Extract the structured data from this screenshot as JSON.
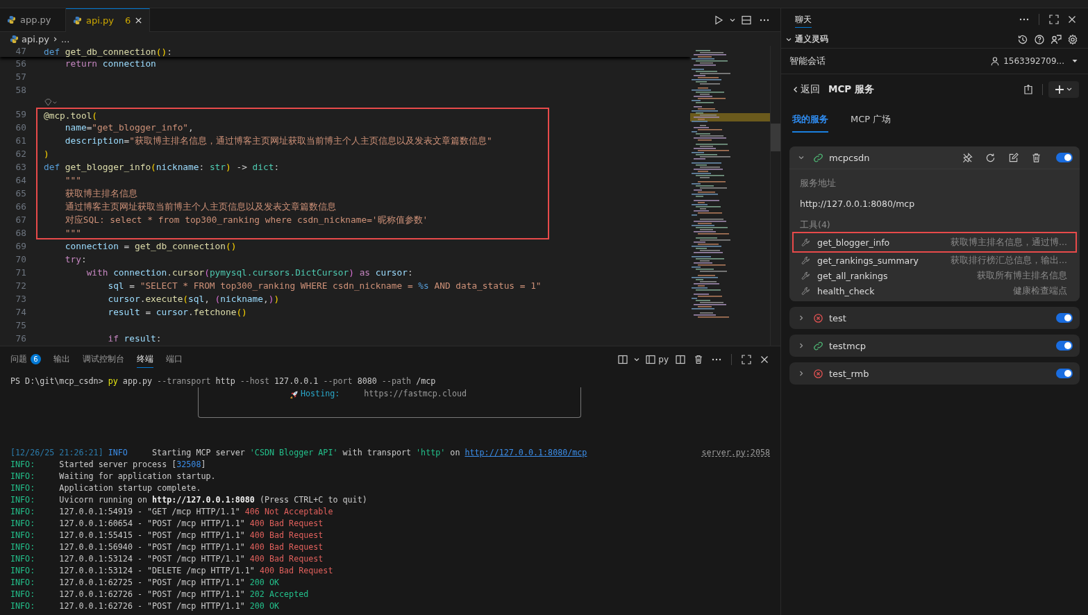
{
  "editor_tabs": [
    {
      "label": "app.py",
      "selected": false,
      "warning": false
    },
    {
      "label": "api.py",
      "selected": true,
      "warning": true,
      "problems": "6"
    }
  ],
  "breadcrumb": [
    "api.py",
    "..."
  ],
  "sticky_line": {
    "number": "47",
    "tokens": [
      {
        "text": "def",
        "kind": "storage"
      },
      {
        "text": " get_db_connection",
        "kind": "fn"
      },
      {
        "text": "()",
        "kind": "bracket"
      },
      {
        "text": ":",
        "kind": "plain"
      }
    ]
  },
  "code_lines": [
    {
      "number": "56",
      "boxed": false,
      "tokens": [
        {
          "text": "    return",
          "kind": "control"
        },
        {
          "text": " connection",
          "kind": "var"
        }
      ]
    },
    {
      "number": "57",
      "boxed": false
    },
    {
      "number": "58",
      "boxed": false
    },
    {
      "number": "59",
      "boxed": true,
      "codelens": true,
      "tokens": [
        {
          "text": "@mcp.tool",
          "kind": "fn"
        },
        {
          "text": "(",
          "kind": "bracket"
        }
      ]
    },
    {
      "number": "60",
      "boxed": true,
      "tokens": [
        {
          "text": "    name",
          "kind": "var"
        },
        {
          "text": "=",
          "kind": "plain"
        },
        {
          "text": "\"get_blogger_info\"",
          "kind": "str"
        },
        {
          "text": ",",
          "kind": "plain"
        }
      ]
    },
    {
      "number": "61",
      "boxed": true,
      "tokens": [
        {
          "text": "    description",
          "kind": "var"
        },
        {
          "text": "=",
          "kind": "plain"
        },
        {
          "text": "\"获取博主排名信息，通过博客主页网址获取当前博主个人主页信息以及发表文章篇数信息\"",
          "kind": "str"
        }
      ]
    },
    {
      "number": "62",
      "boxed": true,
      "tokens": [
        {
          "text": ")",
          "kind": "bracket"
        }
      ]
    },
    {
      "number": "63",
      "boxed": true,
      "tokens": [
        {
          "text": "def",
          "kind": "storage"
        },
        {
          "text": " get_blogger_info",
          "kind": "fn"
        },
        {
          "text": "(",
          "kind": "bracket"
        },
        {
          "text": "nickname",
          "kind": "var"
        },
        {
          "text": ": ",
          "kind": "plain"
        },
        {
          "text": "str",
          "kind": "type"
        },
        {
          "text": ")",
          "kind": "bracket"
        },
        {
          "text": " -> ",
          "kind": "plain"
        },
        {
          "text": "dict",
          "kind": "type"
        },
        {
          "text": ":",
          "kind": "plain"
        }
      ]
    },
    {
      "number": "64",
      "boxed": true,
      "tokens": [
        {
          "text": "    \"\"\"",
          "kind": "str"
        }
      ]
    },
    {
      "number": "65",
      "boxed": true,
      "tokens": [
        {
          "text": "    获取博主排名信息",
          "kind": "str"
        }
      ]
    },
    {
      "number": "66",
      "boxed": true,
      "tokens": [
        {
          "text": "    通过博客主页网址获取当前博主个人主页信息以及发表文章篇数信息",
          "kind": "str"
        }
      ]
    },
    {
      "number": "67",
      "boxed": true,
      "tokens": [
        {
          "text": "    对应SQL: select * from top300_ranking where csdn_nickname='昵称值参数'",
          "kind": "str"
        }
      ]
    },
    {
      "number": "68",
      "boxed": true,
      "tokens": [
        {
          "text": "    \"\"\"",
          "kind": "str"
        }
      ]
    },
    {
      "number": "69",
      "boxed": false,
      "tokens": [
        {
          "text": "    connection",
          "kind": "var"
        },
        {
          "text": " = ",
          "kind": "plain"
        },
        {
          "text": "get_db_connection",
          "kind": "fn"
        },
        {
          "text": "()",
          "kind": "bracket"
        }
      ]
    },
    {
      "number": "70",
      "boxed": false,
      "tokens": [
        {
          "text": "    try",
          "kind": "control"
        },
        {
          "text": ":",
          "kind": "plain"
        }
      ]
    },
    {
      "number": "71",
      "boxed": false,
      "tokens": [
        {
          "text": "        with",
          "kind": "control"
        },
        {
          "text": " connection",
          "kind": "var"
        },
        {
          "text": ".",
          "kind": "plain"
        },
        {
          "text": "cursor",
          "kind": "fn"
        },
        {
          "text": "(",
          "kind": "bracket2"
        },
        {
          "text": "pymysql.cursors.DictCursor",
          "kind": "type"
        },
        {
          "text": ")",
          "kind": "bracket2"
        },
        {
          "text": " as",
          "kind": "control"
        },
        {
          "text": " cursor",
          "kind": "var"
        },
        {
          "text": ":",
          "kind": "plain"
        }
      ]
    },
    {
      "number": "72",
      "boxed": false,
      "tokens": [
        {
          "text": "            sql",
          "kind": "var"
        },
        {
          "text": " = ",
          "kind": "plain"
        },
        {
          "text": "\"SELECT * FROM top300_ranking WHERE csdn_nickname = ",
          "kind": "str"
        },
        {
          "text": "%s",
          "kind": "storage"
        },
        {
          "text": " AND data_status = 1\"",
          "kind": "str"
        }
      ]
    },
    {
      "number": "73",
      "boxed": false,
      "tokens": [
        {
          "text": "            cursor",
          "kind": "var"
        },
        {
          "text": ".",
          "kind": "plain"
        },
        {
          "text": "execute",
          "kind": "fn"
        },
        {
          "text": "(",
          "kind": "bracket"
        },
        {
          "text": "sql",
          "kind": "var"
        },
        {
          "text": ", ",
          "kind": "plain"
        },
        {
          "text": "(",
          "kind": "bracket2"
        },
        {
          "text": "nickname",
          "kind": "var"
        },
        {
          "text": ",",
          "kind": "plain"
        },
        {
          "text": ")",
          "kind": "bracket2"
        },
        {
          "text": ")",
          "kind": "bracket"
        }
      ]
    },
    {
      "number": "74",
      "boxed": false,
      "tokens": [
        {
          "text": "            result",
          "kind": "var"
        },
        {
          "text": " = ",
          "kind": "plain"
        },
        {
          "text": "cursor",
          "kind": "var"
        },
        {
          "text": ".",
          "kind": "plain"
        },
        {
          "text": "fetchone",
          "kind": "fn"
        },
        {
          "text": "()",
          "kind": "bracket"
        }
      ]
    },
    {
      "number": "75",
      "boxed": false
    },
    {
      "number": "76",
      "boxed": false,
      "tokens": [
        {
          "text": "            if",
          "kind": "control"
        },
        {
          "text": " result",
          "kind": "var"
        },
        {
          "text": ":",
          "kind": "plain"
        }
      ]
    }
  ],
  "panel_tabs": [
    {
      "label": "问题",
      "selected": false,
      "badge": "6"
    },
    {
      "label": "输出",
      "selected": false
    },
    {
      "label": "调试控制台",
      "selected": false
    },
    {
      "label": "终端",
      "selected": true
    },
    {
      "label": "端口",
      "selected": false
    }
  ],
  "terminal_name": "py",
  "terminal": {
    "command": [
      {
        "text": "PS D:\\git\\mcp_csdn> ",
        "kind": "plain"
      },
      {
        "text": "py",
        "kind": "yellow"
      },
      {
        "text": " app.py ",
        "kind": "plain"
      },
      {
        "text": "--transport",
        "kind": "muted"
      },
      {
        "text": " http ",
        "kind": "plain"
      },
      {
        "text": "--host",
        "kind": "muted"
      },
      {
        "text": " 127.0.0.1 ",
        "kind": "plain"
      },
      {
        "text": "--port",
        "kind": "muted"
      },
      {
        "text": " 8080 ",
        "kind": "plain"
      },
      {
        "text": "--path",
        "kind": "muted"
      },
      {
        "text": " /mcp",
        "kind": "plain"
      }
    ],
    "banner": {
      "label": "Hosting:",
      "url": "https://fastmcp.cloud"
    },
    "log": [
      {
        "source": "server.py:2058",
        "tokens": [
          {
            "text": "[12/26/25 21:26:21]",
            "kind": "dim"
          },
          {
            "text": " INFO",
            "kind": "blue"
          },
          {
            "text": "     Starting MCP server ",
            "kind": "plain"
          },
          {
            "text": "'CSDN Blogger API'",
            "kind": "green"
          },
          {
            "text": " with transport ",
            "kind": "plain"
          },
          {
            "text": "'http'",
            "kind": "green"
          },
          {
            "text": " on ",
            "kind": "plain"
          },
          {
            "text": "http://127.0.0.1:8080/mcp",
            "kind": "link"
          }
        ]
      },
      {
        "tokens": [
          {
            "text": "INFO:",
            "kind": "green"
          },
          {
            "text": "     Started server process [",
            "kind": "plain"
          },
          {
            "text": "32508",
            "kind": "blue"
          },
          {
            "text": "]",
            "kind": "plain"
          }
        ]
      },
      {
        "tokens": [
          {
            "text": "INFO:",
            "kind": "green"
          },
          {
            "text": "     Waiting for application startup.",
            "kind": "plain"
          }
        ]
      },
      {
        "tokens": [
          {
            "text": "INFO:",
            "kind": "green"
          },
          {
            "text": "     Application startup complete.",
            "kind": "plain"
          }
        ]
      },
      {
        "tokens": [
          {
            "text": "INFO:",
            "kind": "green"
          },
          {
            "text": "     Uvicorn running on ",
            "kind": "plain"
          },
          {
            "text": "http://127.0.0.1:8080",
            "kind": "bold"
          },
          {
            "text": " (Press CTRL+C to quit)",
            "kind": "plain"
          }
        ]
      },
      {
        "tokens": [
          {
            "text": "INFO:",
            "kind": "green"
          },
          {
            "text": "     127.0.0.1:54919 - \"GET /mcp HTTP/1.1\" ",
            "kind": "plain"
          },
          {
            "text": "406 Not Acceptable",
            "kind": "red"
          }
        ]
      },
      {
        "tokens": [
          {
            "text": "INFO:",
            "kind": "green"
          },
          {
            "text": "     127.0.0.1:60654 - \"POST /mcp HTTP/1.1\" ",
            "kind": "plain"
          },
          {
            "text": "400 Bad Request",
            "kind": "red"
          }
        ]
      },
      {
        "tokens": [
          {
            "text": "INFO:",
            "kind": "green"
          },
          {
            "text": "     127.0.0.1:55415 - \"POST /mcp HTTP/1.1\" ",
            "kind": "plain"
          },
          {
            "text": "400 Bad Request",
            "kind": "red"
          }
        ]
      },
      {
        "tokens": [
          {
            "text": "INFO:",
            "kind": "green"
          },
          {
            "text": "     127.0.0.1:56940 - \"POST /mcp HTTP/1.1\" ",
            "kind": "plain"
          },
          {
            "text": "400 Bad Request",
            "kind": "red"
          }
        ]
      },
      {
        "tokens": [
          {
            "text": "INFO:",
            "kind": "green"
          },
          {
            "text": "     127.0.0.1:53124 - \"POST /mcp HTTP/1.1\" ",
            "kind": "plain"
          },
          {
            "text": "400 Bad Request",
            "kind": "red"
          }
        ]
      },
      {
        "tokens": [
          {
            "text": "INFO:",
            "kind": "green"
          },
          {
            "text": "     127.0.0.1:53124 - \"DELETE /mcp HTTP/1.1\" ",
            "kind": "plain"
          },
          {
            "text": "400 Bad Request",
            "kind": "red"
          }
        ]
      },
      {
        "tokens": [
          {
            "text": "INFO:",
            "kind": "green"
          },
          {
            "text": "     127.0.0.1:62725 - \"POST /mcp HTTP/1.1\" ",
            "kind": "plain"
          },
          {
            "text": "200 OK",
            "kind": "green"
          }
        ]
      },
      {
        "tokens": [
          {
            "text": "INFO:",
            "kind": "green"
          },
          {
            "text": "     127.0.0.1:62726 - \"POST /mcp HTTP/1.1\" ",
            "kind": "plain"
          },
          {
            "text": "202 Accepted",
            "kind": "green"
          }
        ]
      },
      {
        "tokens": [
          {
            "text": "INFO:",
            "kind": "green"
          },
          {
            "text": "     127.0.0.1:62726 - \"POST /mcp HTTP/1.1\" ",
            "kind": "plain"
          },
          {
            "text": "200 OK",
            "kind": "green"
          }
        ]
      }
    ]
  },
  "side_panel": {
    "tab": {
      "label": "聊天",
      "selected": true
    },
    "section": "通义灵码",
    "session": "智能会话",
    "user": "1563392709...",
    "back": "返回",
    "title": "MCP 服务",
    "tabs": [
      {
        "label": "我的服务",
        "selected": true
      },
      {
        "label": "MCP 广场",
        "selected": false
      }
    ],
    "services": [
      {
        "name": "mcpcsdn",
        "kind": "connected",
        "expanded": true,
        "enabled": true,
        "address_label": "服务地址",
        "address": "http://127.0.0.1:8080/mcp",
        "tools_label": "工具(4)",
        "tools": [
          {
            "name": "get_blogger_info",
            "description": "获取博主排名信息，通过博...",
            "boxed": true
          },
          {
            "name": "get_rankings_summary",
            "description": "获取排行榜汇总信息，输出...",
            "boxed": false
          },
          {
            "name": "get_all_rankings",
            "description": "获取所有博主排名信息",
            "boxed": false
          },
          {
            "name": "health_check",
            "description": "健康检查端点",
            "boxed": false
          }
        ]
      },
      {
        "name": "test",
        "kind": "error",
        "expanded": false,
        "enabled": true
      },
      {
        "name": "testmcp",
        "kind": "connected",
        "expanded": false,
        "enabled": true
      },
      {
        "name": "test_rmb",
        "kind": "error",
        "expanded": false,
        "enabled": true
      }
    ]
  }
}
